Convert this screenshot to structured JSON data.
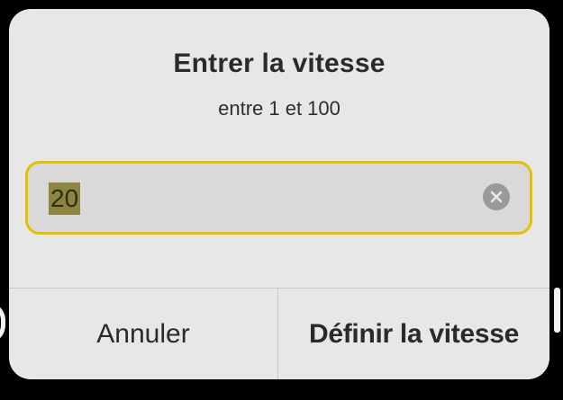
{
  "dialog": {
    "title": "Entrer la vitesse",
    "subtitle": "entre 1 et 100",
    "input": {
      "value": "20",
      "value_selected": true,
      "clear_icon": "clear-icon"
    },
    "buttons": {
      "cancel_label": "Annuler",
      "confirm_label": "Définir la vitesse"
    }
  },
  "colors": {
    "dialog_background": "#e7e7e7",
    "field_border_focus": "#e3c000",
    "selection_highlight": "#8e8540",
    "screen_background": "#000000"
  }
}
